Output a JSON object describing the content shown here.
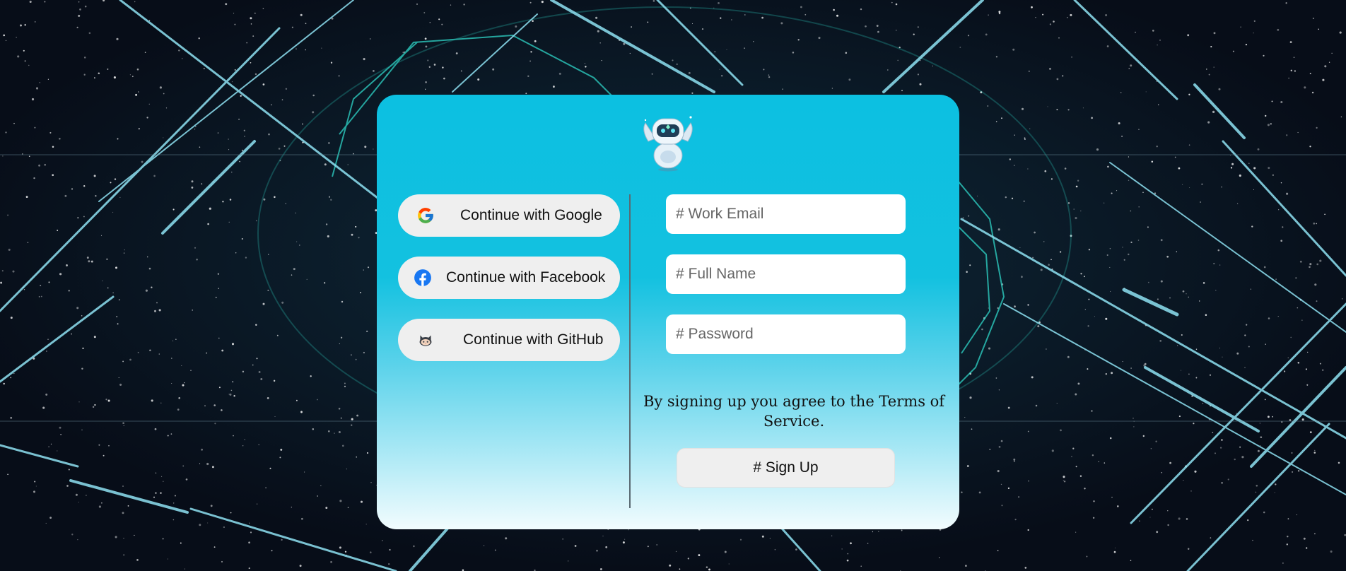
{
  "oauth": {
    "google_label": "Continue with Google",
    "facebook_label": "Continue with Facebook",
    "github_label": "Continue with GitHub"
  },
  "form": {
    "email_placeholder": "# Work Email",
    "name_placeholder": "# Full Name",
    "password_placeholder": "# Password",
    "terms_text": "By signing up you agree to the Terms of Service.",
    "signup_label": "# Sign Up"
  },
  "icons": {
    "logo": "robot-mascot-icon",
    "google": "google-icon",
    "facebook": "facebook-icon",
    "github": "github-icon"
  },
  "colors": {
    "card_top": "#0cc0e1",
    "card_bottom": "#f2fcfe",
    "button_bg": "#efefef",
    "background": "#0a1220",
    "accent_lines": "#7fdcef"
  }
}
